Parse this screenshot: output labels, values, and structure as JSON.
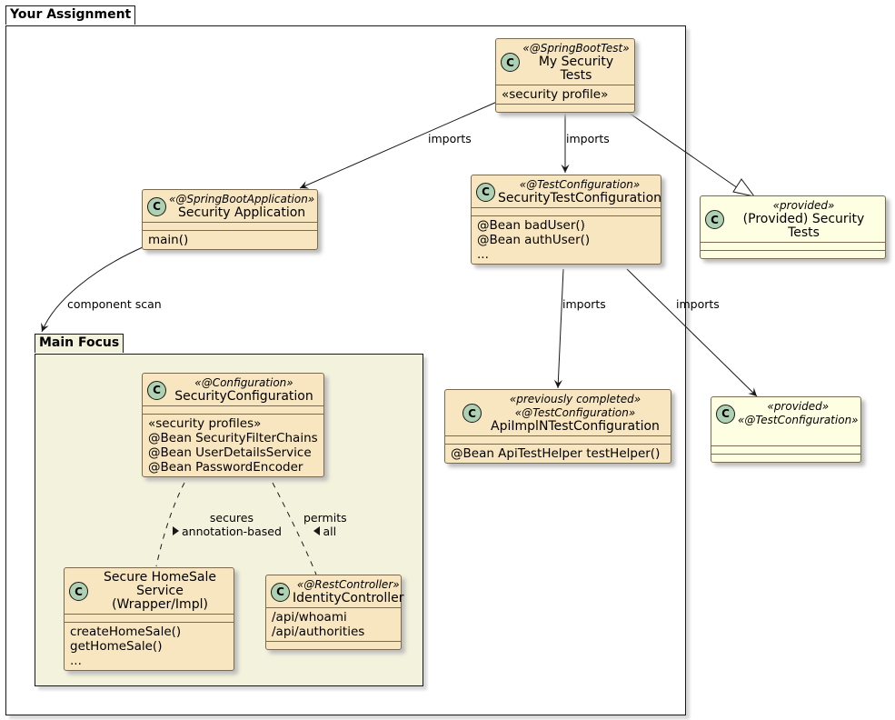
{
  "packages": {
    "outer": {
      "title": "Your Assignment",
      "background": "#ffffff"
    },
    "main_focus": {
      "title": "Main Focus",
      "background": "#f3f2dd"
    }
  },
  "classes": {
    "my_security_tests": {
      "stereotype": "«@SpringBootTest»",
      "name": "My Security Tests",
      "fields": [
        "«security profile»"
      ],
      "methods": []
    },
    "security_application": {
      "stereotype": "«@SpringBootApplication»",
      "name": "Security Application",
      "fields": [],
      "methods": [
        "main()"
      ]
    },
    "security_test_configuration": {
      "stereotype": "«@TestConfiguration»",
      "name": "SecurityTestConfiguration",
      "fields": [],
      "methods": [
        "@Bean badUser()",
        "@Bean authUser()",
        "..."
      ]
    },
    "provided_security_tests": {
      "stereotype": "«provided»",
      "name": "(Provided) Security Tests",
      "fields": [],
      "methods": []
    },
    "security_configuration": {
      "stereotype": "«@Configuration»",
      "name": "SecurityConfiguration",
      "fields": [],
      "methods": [
        "«security profiles»",
        "@Bean SecurityFilterChains",
        "@Bean UserDetailsService",
        "@Bean PasswordEncoder"
      ]
    },
    "secure_homesale_service": {
      "name_line1": "Secure HomeSale",
      "name_line2": "Service (Wrapper/Impl)",
      "fields": [],
      "methods": [
        "createHomeSale()",
        "getHomeSale()",
        "..."
      ]
    },
    "identity_controller": {
      "stereotype": "«@RestController»",
      "name": "IdentityController",
      "fields": [
        "/api/whoami",
        "/api/authorities"
      ],
      "methods": []
    },
    "apiimpln_test_configuration": {
      "stereotype1": "«previously completed»",
      "stereotype2": "«@TestConfiguration»",
      "name": "ApiImplNTestConfiguration",
      "fields": [],
      "methods": [
        "@Bean ApiTestHelper testHelper()"
      ]
    },
    "provided_test_configuration": {
      "stereotype1": "«provided»",
      "stereotype2": "«@TestConfiguration»",
      "fields": [],
      "methods": []
    }
  },
  "class_icon_letter": "C",
  "relations": {
    "tests_to_app": "imports",
    "tests_to_testconfig": "imports",
    "app_to_mainfocus": "component scan",
    "testconfig_to_apiimpl": "imports",
    "testconfig_to_provided": "imports",
    "secures_line1": "secures",
    "secures_line2": "annotation-based",
    "permits_line1": "permits",
    "permits_line2": "all"
  },
  "colors": {
    "class_fill": "#f8e6c1",
    "provided_fill": "#fefee2",
    "icon_fill": "#add1b2",
    "line": "#181818"
  }
}
